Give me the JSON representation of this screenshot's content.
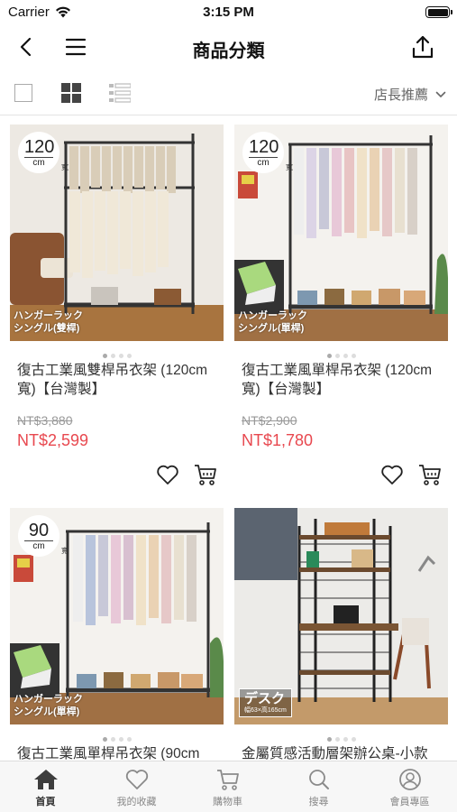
{
  "status_bar": {
    "carrier": "Carrier",
    "time": "3:15 PM"
  },
  "nav": {
    "title": "商品分類"
  },
  "toolbar": {
    "sort_label": "店長推薦"
  },
  "products": [
    {
      "size_num": "120",
      "size_unit": "cm",
      "size_side": "寬",
      "caption_line1": "ハンガーラック",
      "caption_line2": "シングル(雙桿)",
      "name": "復古工業風雙桿吊衣架 (120cm 寬)【台灣製】",
      "price_old": "NT$3,880",
      "price_new": "NT$2,599"
    },
    {
      "size_num": "120",
      "size_unit": "cm",
      "size_side": "寬",
      "caption_line1": "ハンガーラック",
      "caption_line2": "シングル(單桿)",
      "name": "復古工業風單桿吊衣架 (120cm 寬)【台灣製】",
      "price_old": "NT$2,900",
      "price_new": "NT$1,780"
    },
    {
      "size_num": "90",
      "size_unit": "cm",
      "size_side": "寬",
      "caption_line1": "ハンガーラック",
      "caption_line2": "シングル(單桿)",
      "name": "復古工業風單桿吊衣架 (90cm"
    },
    {
      "caption_big": "デスク",
      "caption_small": "幅63×高165cm",
      "name": "金屬質感活動層架辦公桌-小款"
    }
  ],
  "tabs": [
    {
      "label": "首頁",
      "icon": "home-icon",
      "active": true
    },
    {
      "label": "我的收藏",
      "icon": "heart-icon"
    },
    {
      "label": "購物車",
      "icon": "cart-icon"
    },
    {
      "label": "搜尋",
      "icon": "search-icon"
    },
    {
      "label": "會員專區",
      "icon": "user-icon"
    }
  ],
  "colors": {
    "price": "#e8484f",
    "strike": "#999999",
    "tab_active": "#333333",
    "tab_inactive": "#888888"
  }
}
